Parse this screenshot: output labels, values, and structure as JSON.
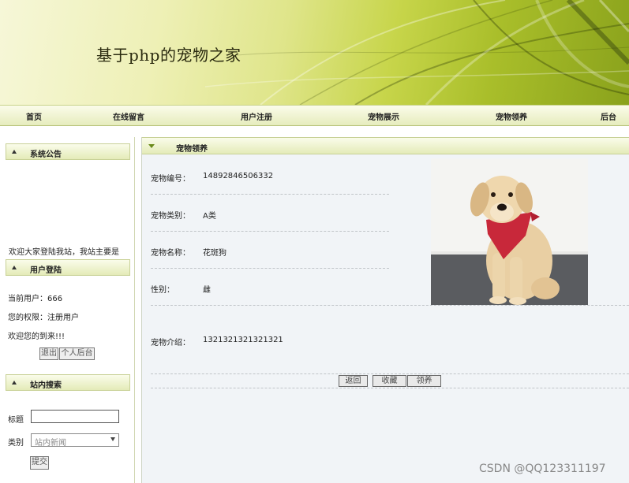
{
  "site": {
    "title": "基于php的宠物之家"
  },
  "nav": {
    "items": [
      "首页",
      "在线留言",
      "用户注册",
      "宠物展示",
      "宠物领养",
      "后台"
    ]
  },
  "sidebar": {
    "notice": {
      "title": "系统公告",
      "text": "欢迎大家登陆我站，我站主要是"
    },
    "login": {
      "title": "用户登陆",
      "current_user": "当前用户：666",
      "permission": "您的权限：注册用户",
      "welcome": "欢迎您的到来!!!",
      "logout_button": "退出",
      "personal_button": "个人后台"
    },
    "search": {
      "title": "站内搜索",
      "title_label": "标题",
      "title_value": "",
      "category_label": "类别",
      "category_value": "站内新闻",
      "submit_button": "提交"
    }
  },
  "main": {
    "section_title": "宠物领养",
    "fields": [
      {
        "label": "宠物编号：",
        "value": "14892846506332"
      },
      {
        "label": "宠物类别：",
        "value": "A类"
      },
      {
        "label": "宠物名称：",
        "value": "花斑狗"
      },
      {
        "label": "性别：",
        "value": "雌"
      },
      {
        "label": "宠物介绍：",
        "value": "1321321321321321"
      }
    ],
    "photo_icon": "dog-photo",
    "buttons": {
      "back": "返回",
      "favorite": "收藏",
      "adopt": "领养"
    }
  },
  "watermark": "CSDN @QQ123311197"
}
